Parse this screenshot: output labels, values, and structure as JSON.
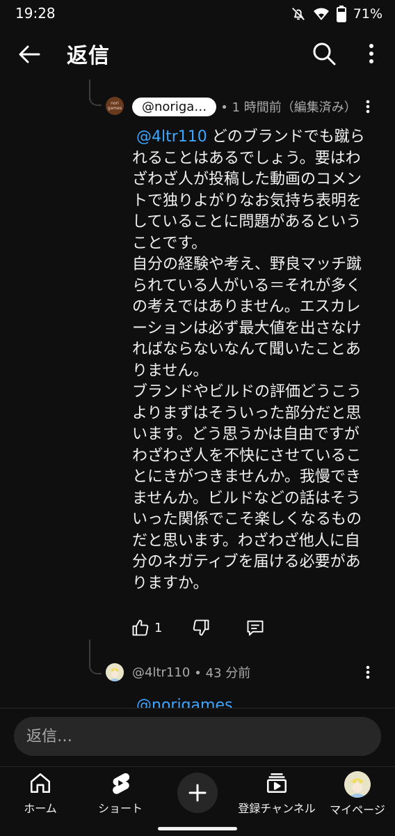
{
  "status_bar": {
    "time": "19:28",
    "battery": "71%",
    "icons": [
      "mute-icon",
      "wifi-icon",
      "battery-icon"
    ]
  },
  "header": {
    "title": "返信",
    "back_icon": "arrow-left-icon",
    "search_icon": "search-icon",
    "more_icon": "more-vert-icon"
  },
  "comments": [
    {
      "handle": "@noriga…",
      "meta": "• 1 時間前（編集済み）",
      "avatar_text": "nori games",
      "mention": "@4ltr110",
      "lines": [
        "どのブランドでも蹴ら",
        "れることはあるでしょう。要はわ",
        "ざわざ人が投稿した動画のコメン",
        "トで独りよがりなお気持ち表明を",
        "していることに問題があるという",
        "ことです。",
        "自分の経験や考え、野良マッチ蹴",
        "られている人がいる＝それが多く",
        "の考えではありません。エスカレ",
        "ーションは必ず最大値を出さなけ",
        "ればならないなんて聞いたことあ",
        "りません。",
        "ブランドやビルドの評価どうこう",
        "よりまずはそういった部分だと思",
        "います。どう思うかは自由ですが",
        "わざわざ人を不快にさせているこ",
        "とにきがつきませんか。我慢でき",
        "ませんか。ビルドなどの話はそう",
        "いった関係でこそ楽しくなるもの",
        "だと思います。わざわざ他人に自",
        "分のネガティブを届ける必要があ",
        "りますか。"
      ],
      "like_count": "1",
      "actions": [
        "like-icon",
        "dislike-icon",
        "reply-icon"
      ]
    },
    {
      "handle": "@4ltr110",
      "meta": "• 43 分前",
      "partial_text": "@norigames"
    }
  ],
  "reply_bar": {
    "placeholder": "返信…"
  },
  "bottom_nav": {
    "items": [
      {
        "label": "ホーム",
        "icon": "home-icon"
      },
      {
        "label": "ショート",
        "icon": "shorts-icon"
      },
      {
        "label": "",
        "icon": "create-plus-icon"
      },
      {
        "label": "登録チャンネル",
        "icon": "subscriptions-icon"
      },
      {
        "label": "マイページ",
        "icon": "avatar"
      }
    ]
  },
  "colors": {
    "background": "#0f0f0f",
    "text": "#f1f1f1",
    "secondary_text": "#aaaaaa",
    "mention": "#3ea6ff",
    "surface": "#272727"
  }
}
